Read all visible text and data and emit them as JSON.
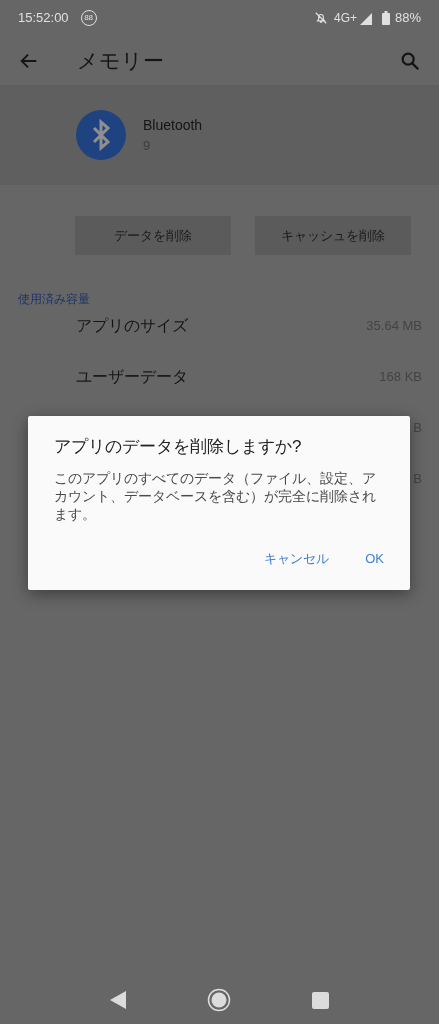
{
  "status_bar": {
    "time": "15:52:00",
    "badge": "88",
    "network": "4G+",
    "battery": "88%"
  },
  "app_bar": {
    "title": "メモリー"
  },
  "app": {
    "name": "Bluetooth",
    "version": "9"
  },
  "buttons": [
    "データを削除",
    "キャッシュを削除"
  ],
  "section": {
    "title": "使用済み容量"
  },
  "rows": [
    {
      "label": "アプリのサイズ",
      "value": "35.64 MB"
    },
    {
      "label": "ユーザーデータ",
      "value": "168 KB"
    },
    {
      "value": "B"
    },
    {
      "value": "B"
    }
  ],
  "dialog": {
    "title": "アプリのデータを削除しますか?",
    "message": "このアプリのすべてのデータ（ファイル、設定、アカウント、データベースを含む）が完全に削除されます。",
    "buttons": [
      "キャンセル",
      "OK"
    ]
  }
}
